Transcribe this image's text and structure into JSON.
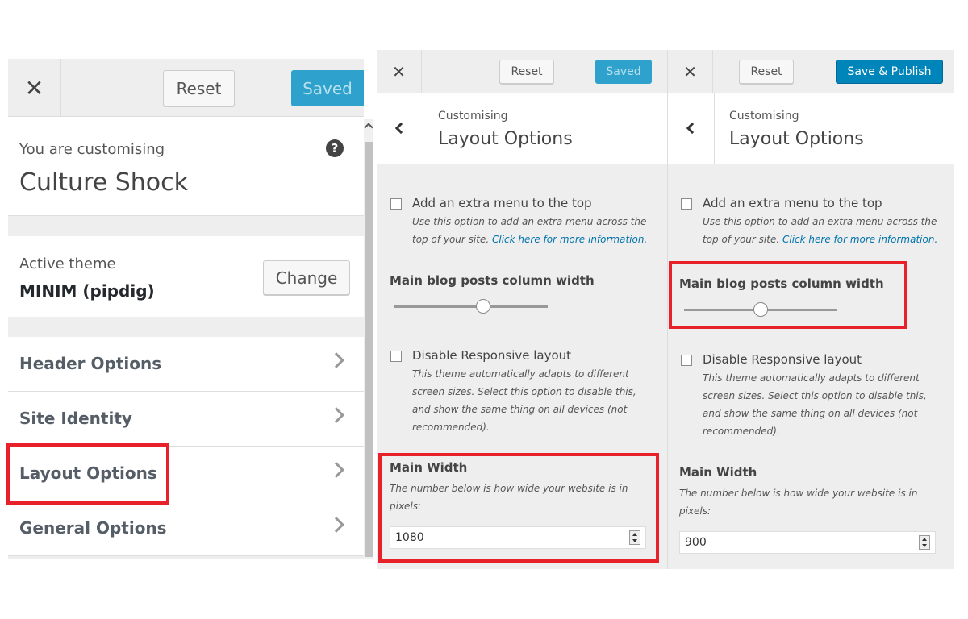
{
  "panel1": {
    "close_icon": "close-icon",
    "reset_label": "Reset",
    "saved_label": "Saved",
    "customising_label": "You are customising",
    "site_title": "Culture Shock",
    "help_glyph": "?",
    "active_theme_label": "Active theme",
    "theme_name": "MINIM (pipdig)",
    "change_label": "Change",
    "menu": [
      {
        "label": "Header Options"
      },
      {
        "label": "Site Identity"
      },
      {
        "label": "Layout Options"
      },
      {
        "label": "General Options"
      }
    ]
  },
  "panel2": {
    "reset_label": "Reset",
    "saved_label": "Saved",
    "crumb": "Customising",
    "section_title": "Layout Options",
    "extra_menu_label": "Add an extra menu to the top",
    "extra_menu_desc_1": "Use this option to add an extra menu across the",
    "extra_menu_desc_2": "top of your site.",
    "extra_menu_link": "Click here for more information.",
    "column_width_title": "Main blog posts column width",
    "column_width_level": 0.58,
    "responsive_label": "Disable Responsive layout",
    "responsive_desc_1": "This theme automatically adapts to different",
    "responsive_desc_2": "screen sizes. Select this option to disable this,",
    "responsive_desc_3": "and show the same thing on all devices (not",
    "responsive_desc_4": "recommended).",
    "main_width_title": "Main Width",
    "main_width_desc_1": "The number below is how wide your website is in",
    "main_width_desc_2": "pixels:",
    "main_width_value": "1080"
  },
  "panel3": {
    "reset_label": "Reset",
    "publish_label": "Save & Publish",
    "crumb": "Customising",
    "section_title": "Layout Options",
    "extra_menu_label": "Add an extra menu to the top",
    "extra_menu_desc_1": "Use this option to add an extra menu across the",
    "extra_menu_desc_2": "top of your site.",
    "extra_menu_link": "Click here for more information.",
    "column_width_title": "Main blog posts column width",
    "column_width_level": 0.5,
    "responsive_label": "Disable Responsive layout",
    "responsive_desc_1": "This theme automatically adapts to different",
    "responsive_desc_2": "screen sizes. Select this option to disable this,",
    "responsive_desc_3": "and show the same thing on all devices (not",
    "responsive_desc_4": "recommended).",
    "main_width_title": "Main Width",
    "main_width_desc_1": "The number below is how wide your website is in",
    "main_width_desc_2": "pixels:",
    "main_width_value": "900"
  },
  "colors": {
    "highlight": "#e8202a",
    "saved_button": "#2ea2cc",
    "publish_button": "#0085ba",
    "link": "#0073aa"
  }
}
